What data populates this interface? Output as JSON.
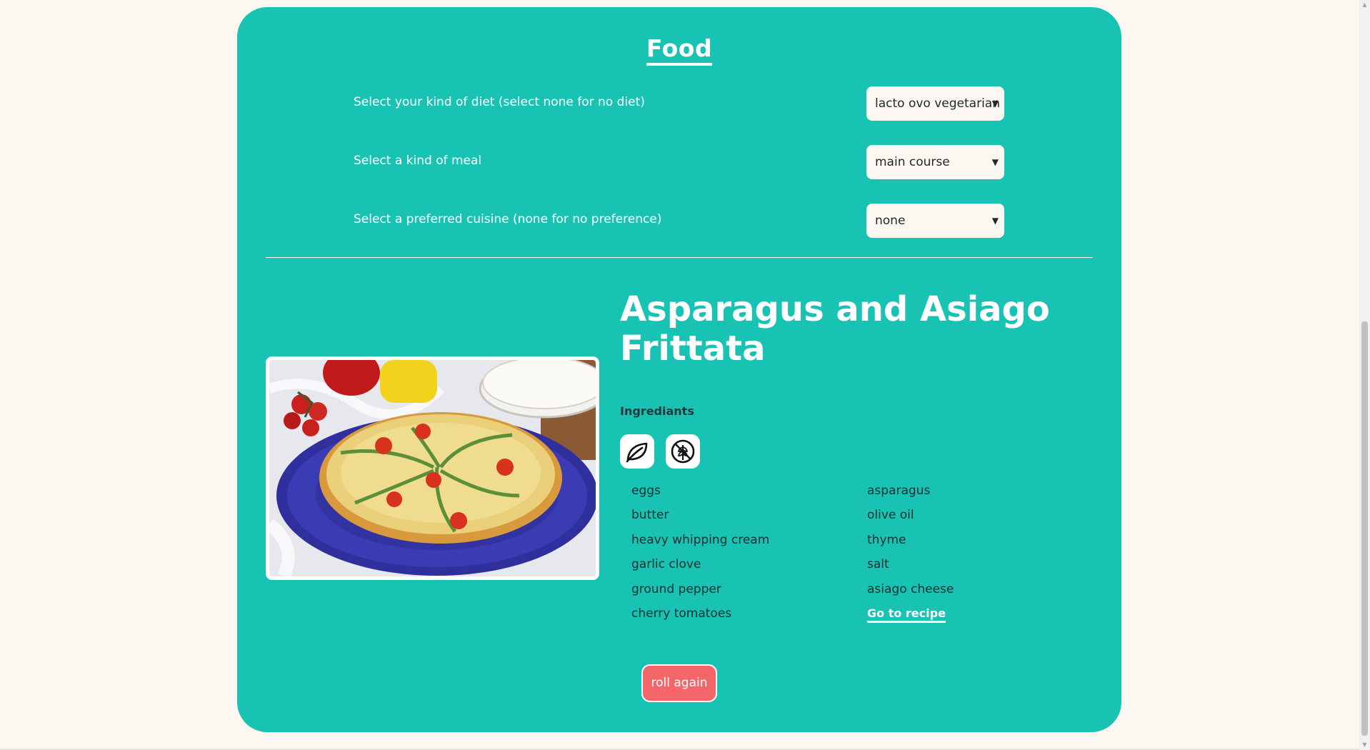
{
  "section": {
    "title": "Food"
  },
  "filters": [
    {
      "label": "Select your kind of diet (select none for no diet)",
      "value": "lacto ovo vegetarian"
    },
    {
      "label": "Select a kind of meal",
      "value": "main course"
    },
    {
      "label": "Select a preferred cuisine (none for no preference)",
      "value": "none"
    }
  ],
  "recipe": {
    "title": "Asparagus and Asiago Frittata",
    "ingredients_heading": "Ingrediants",
    "diet_icons": [
      "leaf-icon",
      "gluten-free-icon"
    ],
    "ingredients_left": [
      "eggs",
      "butter",
      "heavy whipping cream",
      "garlic clove",
      "ground pepper",
      "cherry tomatoes"
    ],
    "ingredients_right": [
      "asparagus",
      "olive oil",
      "thyme",
      "salt",
      "asiago cheese"
    ],
    "link_label": "Go to recipe"
  },
  "actions": {
    "roll_label": "roll again"
  },
  "colors": {
    "card": "#19c3b4",
    "background": "#fcf7f0",
    "button": "#f5666b"
  }
}
